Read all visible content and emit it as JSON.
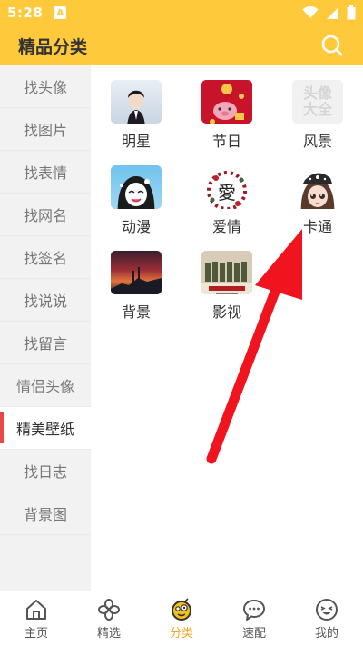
{
  "status_bar": {
    "time": "5:28",
    "notification_letter": "A"
  },
  "header": {
    "title": "精品分类"
  },
  "sidebar": {
    "items": [
      {
        "label": "找头像"
      },
      {
        "label": "找图片"
      },
      {
        "label": "找表情"
      },
      {
        "label": "找网名"
      },
      {
        "label": "找签名"
      },
      {
        "label": "找说说"
      },
      {
        "label": "找留言"
      },
      {
        "label": "情侣头像"
      },
      {
        "label": "精美壁纸"
      },
      {
        "label": "找日志"
      },
      {
        "label": "背景图"
      }
    ],
    "active_index": 8
  },
  "categories": [
    {
      "label": "明星"
    },
    {
      "label": "节日"
    },
    {
      "label": "风景",
      "watermark": "头像大全"
    },
    {
      "label": "动漫"
    },
    {
      "label": "爱情",
      "symbol": "愛"
    },
    {
      "label": "卡通"
    },
    {
      "label": "背景"
    },
    {
      "label": "影视"
    }
  ],
  "bottom_nav": [
    {
      "label": "主页",
      "icon": "home-icon"
    },
    {
      "label": "精选",
      "icon": "clover-icon"
    },
    {
      "label": "分类",
      "icon": "category-face-icon"
    },
    {
      "label": "速配",
      "icon": "chat-bubble-icon"
    },
    {
      "label": "我的",
      "icon": "smiley-icon"
    }
  ],
  "colors": {
    "brand_yellow": "#FFC93C",
    "active_red": "#E84848",
    "nav_active": "#F5A623",
    "annotation_arrow": "#F0141E"
  }
}
